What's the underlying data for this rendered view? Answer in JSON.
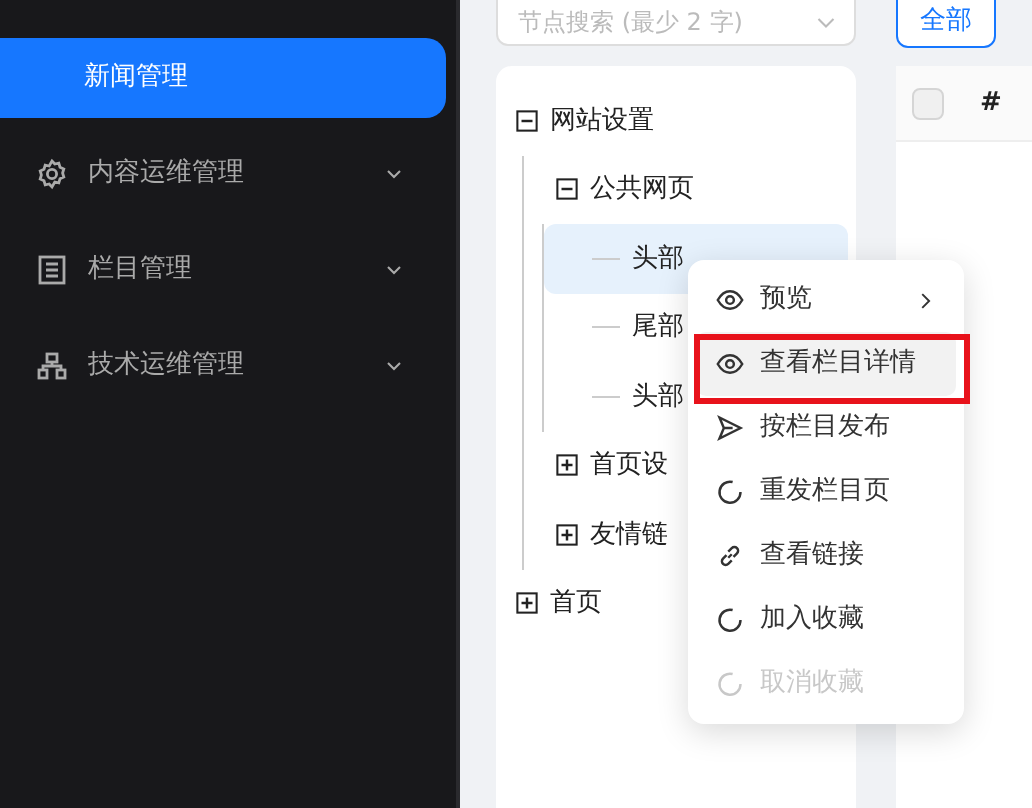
{
  "sidebar": {
    "items": [
      {
        "label": "新闻管理",
        "selected": true,
        "expandable": false
      },
      {
        "label": "内容运维管理",
        "selected": false,
        "expandable": true
      },
      {
        "label": "栏目管理",
        "selected": false,
        "expandable": true
      },
      {
        "label": "技术运维管理",
        "selected": false,
        "expandable": true
      }
    ]
  },
  "tree_search": {
    "placeholder": "节点搜索 (最少 2 字)"
  },
  "tree": [
    {
      "label": "网站设置",
      "expanded": true,
      "children": [
        {
          "label": "公共网页",
          "expanded": true,
          "children": [
            {
              "label": "头部",
              "selected": true
            },
            {
              "label": "尾部",
              "selected": false
            },
            {
              "label": "头部",
              "selected": false
            }
          ]
        },
        {
          "label": "首页设",
          "expanded": false
        },
        {
          "label": "友情链",
          "expanded": false
        }
      ]
    },
    {
      "label": "首页",
      "expanded": false
    }
  ],
  "filter_button": "全部",
  "table": {
    "select_all_checked": false,
    "columns": [
      "#"
    ]
  },
  "context_menu": [
    {
      "label": "预览",
      "submenu": true,
      "hovered": false,
      "highlighted": false,
      "disabled": false
    },
    {
      "label": "查看栏目详情",
      "submenu": false,
      "hovered": true,
      "highlighted": true,
      "disabled": false
    },
    {
      "label": "按栏目发布",
      "submenu": false,
      "hovered": false,
      "highlighted": false,
      "disabled": false
    },
    {
      "label": "重发栏目页",
      "submenu": false,
      "hovered": false,
      "highlighted": false,
      "disabled": false
    },
    {
      "label": "查看链接",
      "submenu": false,
      "hovered": false,
      "highlighted": false,
      "disabled": false
    },
    {
      "label": "加入收藏",
      "submenu": false,
      "hovered": false,
      "highlighted": false,
      "disabled": false
    },
    {
      "label": "取消收藏",
      "submenu": false,
      "hovered": false,
      "highlighted": false,
      "disabled": true
    }
  ]
}
